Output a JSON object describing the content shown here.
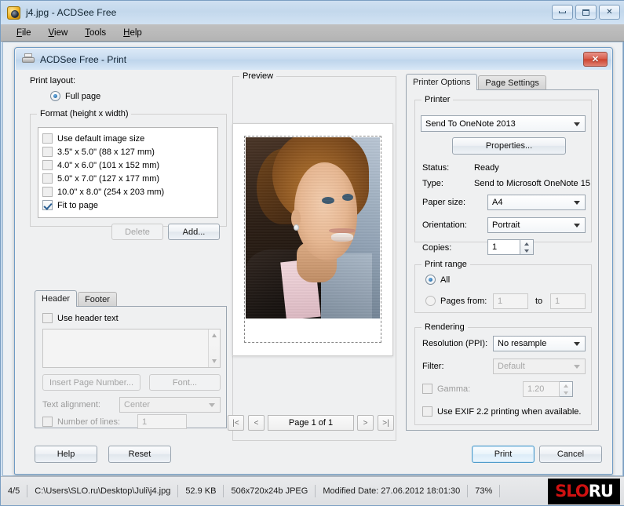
{
  "app": {
    "title": "j4.jpg - ACDSee Free",
    "icon": "camera-icon",
    "window_controls": {
      "minimize": "minimize-icon",
      "maximize": "maximize-icon",
      "close": "✕"
    },
    "menu": [
      {
        "label": "File",
        "mnemonic": "F"
      },
      {
        "label": "View",
        "mnemonic": "V"
      },
      {
        "label": "Tools",
        "mnemonic": "T"
      },
      {
        "label": "Help",
        "mnemonic": "H"
      }
    ]
  },
  "dialog": {
    "title": "ACDSee Free - Print",
    "icon": "printer-icon",
    "close_label": "✕",
    "left": {
      "print_layout_label": "Print layout:",
      "full_page_label": "Full page",
      "full_page_checked": true,
      "format_group_title": "Format (height x width)",
      "format_items": [
        {
          "label": "Use default image size",
          "checked": false
        },
        {
          "label": "3.5\" x 5.0\" (88 x 127 mm)",
          "checked": false
        },
        {
          "label": "4.0\" x 6.0\" (101 x 152 mm)",
          "checked": false
        },
        {
          "label": "5.0\" x 7.0\" (127 x 177 mm)",
          "checked": false
        },
        {
          "label": "10.0\" x 8.0\" (254 x 203 mm)",
          "checked": false
        },
        {
          "label": "Fit to page",
          "checked": true
        }
      ],
      "delete_label": "Delete",
      "delete_enabled": false,
      "add_label": "Add...",
      "add_enabled": true,
      "tabs": [
        {
          "label": "Header",
          "active": true
        },
        {
          "label": "Footer",
          "active": false
        }
      ],
      "use_header_text_label": "Use header text",
      "use_header_text_checked": false,
      "header_text_value": "",
      "insert_page_number_label": "Insert Page Number...",
      "font_label": "Font...",
      "text_alignment_label": "Text alignment:",
      "text_alignment_value": "Center",
      "number_of_lines_label": "Number of lines:",
      "number_of_lines_checked": false,
      "number_of_lines_value": "1"
    },
    "preview": {
      "group_title": "Preview",
      "first_label": "|<",
      "prev_label": "<",
      "page_indicator": "Page 1 of 1",
      "next_label": ">",
      "last_label": ">|"
    },
    "right": {
      "tabs": [
        {
          "label": "Printer Options",
          "active": true
        },
        {
          "label": "Page Settings",
          "active": false
        }
      ],
      "printer_group_title": "Printer",
      "printer_value": "Send To OneNote 2013",
      "properties_label": "Properties...",
      "status_label": "Status:",
      "status_value": "Ready",
      "type_label": "Type:",
      "type_value": "Send to Microsoft OneNote 15",
      "paper_size_label": "Paper size:",
      "paper_size_value": "A4",
      "orientation_label": "Orientation:",
      "orientation_value": "Portrait",
      "copies_label": "Copies:",
      "copies_value": "1",
      "print_range_group_title": "Print range",
      "all_label": "All",
      "all_checked": true,
      "pages_from_label": "Pages from:",
      "pages_from_checked": false,
      "pages_from_value": "1",
      "to_label": "to",
      "pages_to_value": "1",
      "rendering_group_title": "Rendering",
      "resolution_label": "Resolution (PPI):",
      "resolution_value": "No resample",
      "filter_label": "Filter:",
      "filter_value": "Default",
      "gamma_label": "Gamma:",
      "gamma_checked": false,
      "gamma_value": "1.20",
      "exif_label": "Use EXIF 2.2 printing when available.",
      "exif_checked": false
    },
    "footer": {
      "help_label": "Help",
      "reset_label": "Reset",
      "print_label": "Print",
      "cancel_label": "Cancel"
    }
  },
  "status_bar": {
    "index": "4/5",
    "path": "C:\\Users\\SLO.ru\\Desktop\\Juli\\j4.jpg",
    "size": "52.9 KB",
    "dimensions": "506x720x24b JPEG",
    "modified": "Modified Date: 27.06.2012 18:01:30",
    "zoom": "73%",
    "watermark": {
      "part1": "SLO",
      "part2": "RU"
    }
  },
  "colors": {
    "title_gradient_top": "#cfe0f1",
    "menu_bar": "#bcbcbc",
    "dialog_bg": "#eff0f1",
    "close_red": "#cd4430",
    "accent_blue": "#4f9ccb",
    "logo_red": "#cf1111"
  }
}
